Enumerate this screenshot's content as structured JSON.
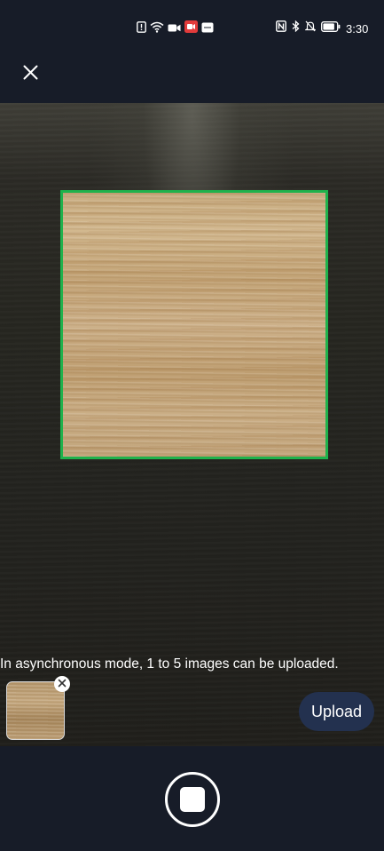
{
  "status_bar": {
    "time": "3:30",
    "left_icons": [
      "sim-alert-icon",
      "wifi-icon",
      "video-icon",
      "screen-record-icon",
      "hd-icon"
    ],
    "right_icons": [
      "nfc-icon",
      "bluetooth-icon",
      "mute-icon",
      "battery-icon"
    ]
  },
  "toolbar": {
    "close_icon": "close-icon"
  },
  "camera": {
    "hint": "In asynchronous mode, 1 to 5 images can be uploaded.",
    "upload_label": "Upload",
    "frame_color": "#1fb24c",
    "thumbnail_remove_icon": "close-icon"
  },
  "capture": {
    "icon": "stop-capture-icon"
  },
  "colors": {
    "background": "#171c28",
    "upload_button": "#23314f",
    "frame": "#1fb24c"
  }
}
